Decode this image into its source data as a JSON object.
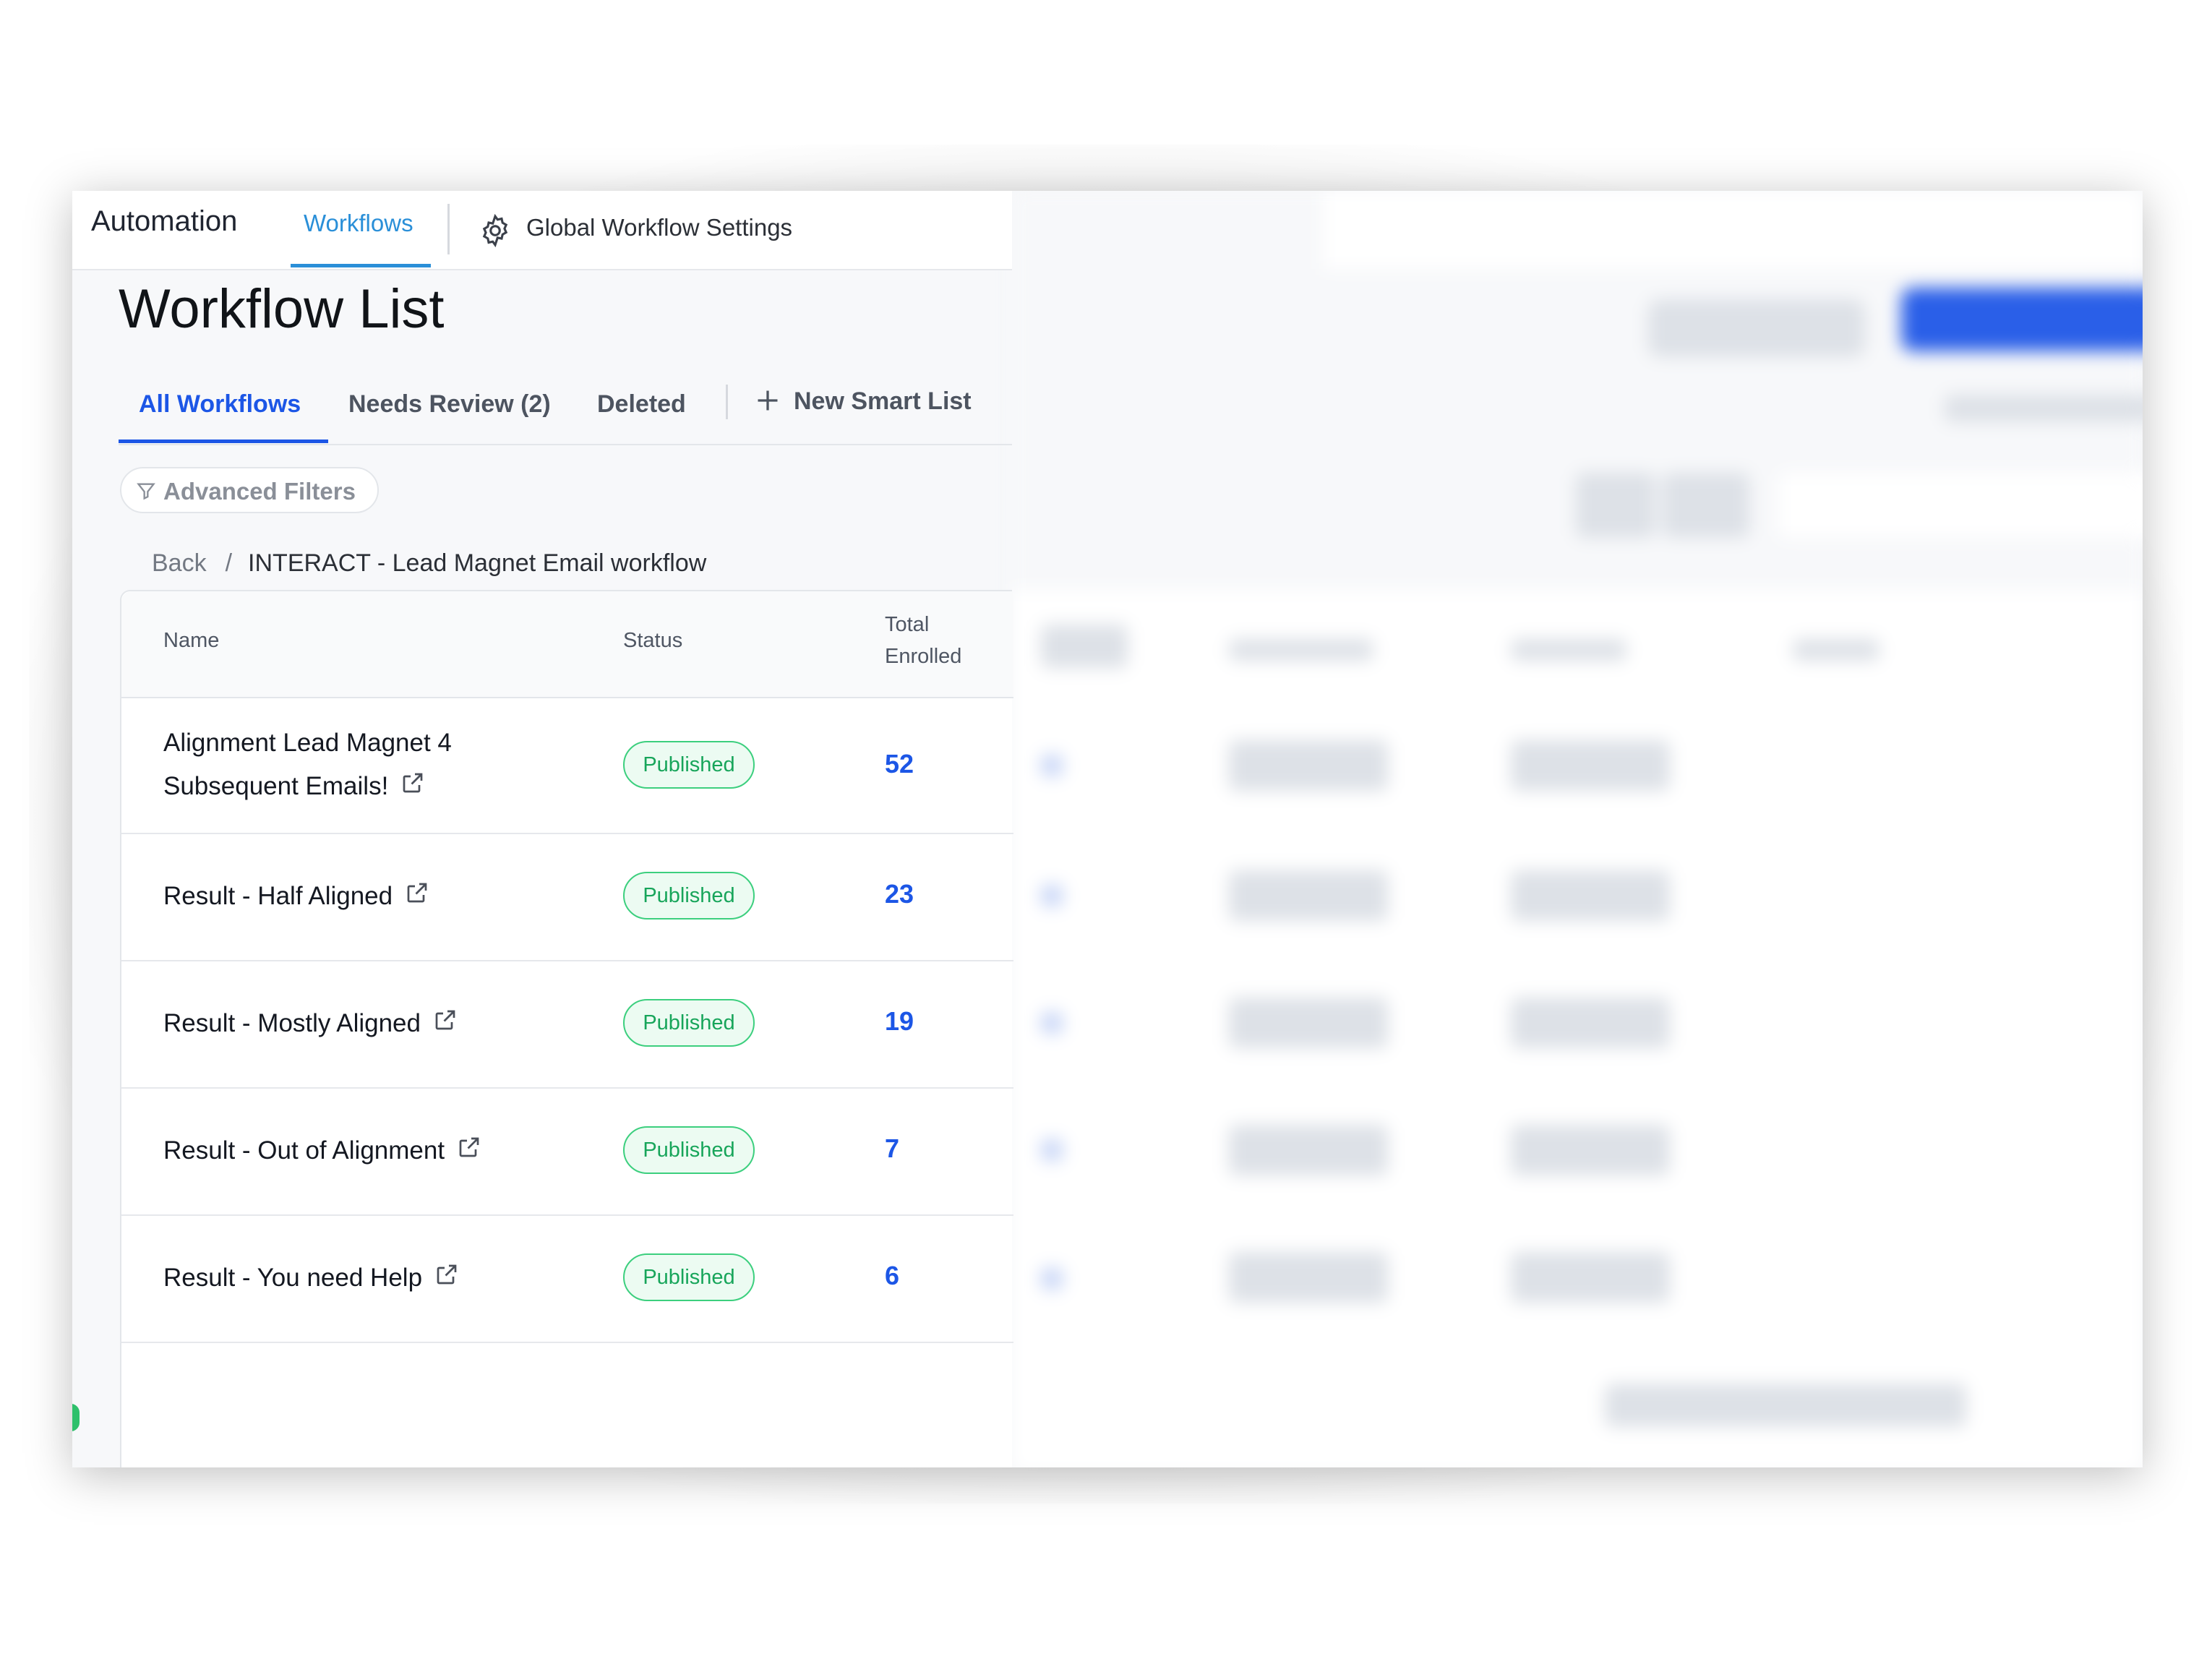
{
  "app": {
    "title": "Automation"
  },
  "topnav": {
    "active_tab": "Workflows",
    "settings_label": "Global Workflow Settings"
  },
  "page": {
    "title": "Workflow List"
  },
  "subtabs": {
    "all": "All Workflows",
    "needs_review": "Needs Review (2)",
    "deleted": "Deleted",
    "new_smart_list": "New Smart List"
  },
  "filters": {
    "advanced_label": "Advanced Filters"
  },
  "breadcrumb": {
    "back": "Back",
    "separator": "/",
    "current": "INTERACT - Lead Magnet Email workflow"
  },
  "table": {
    "columns": {
      "name": "Name",
      "status": "Status",
      "enrolled_line1": "Total",
      "enrolled_line2": "Enrolled"
    },
    "rows": [
      {
        "name_line1": "Alignment Lead Magnet 4",
        "name_line2": "Subsequent Emails!",
        "status": "Published",
        "enrolled": "52"
      },
      {
        "name_line1": "Result - Half Aligned",
        "status": "Published",
        "enrolled": "23"
      },
      {
        "name_line1": "Result - Mostly Aligned",
        "status": "Published",
        "enrolled": "19"
      },
      {
        "name_line1": "Result - Out of Alignment",
        "status": "Published",
        "enrolled": "7"
      },
      {
        "name_line1": "Result - You need Help",
        "status": "Published",
        "enrolled": "6"
      }
    ]
  },
  "colors": {
    "accent": "#1c56e6",
    "nav_accent": "#2a8fd8",
    "published_green": "#17a55a"
  },
  "icons": {
    "settings": "gear-icon",
    "add": "plus-icon",
    "filter": "filter-icon",
    "open": "external-link-icon"
  }
}
